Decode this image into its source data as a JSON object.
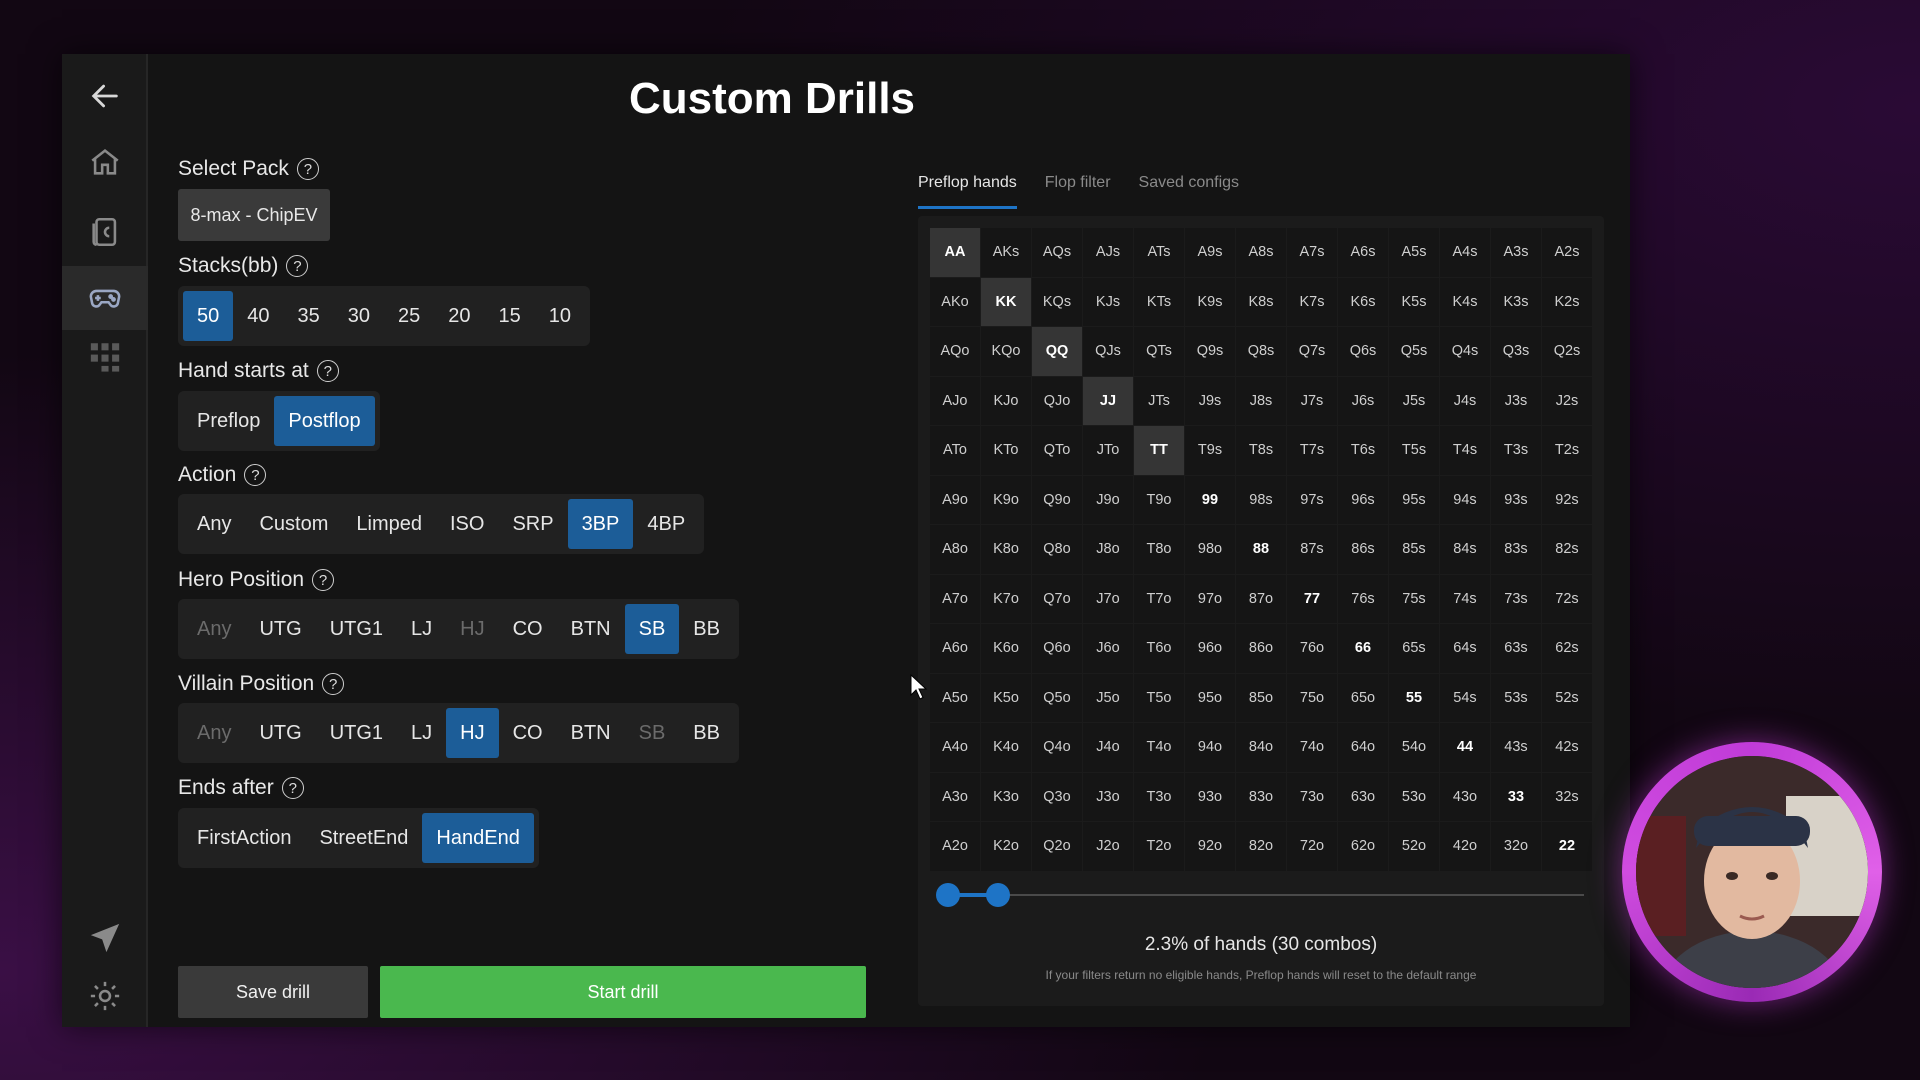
{
  "title": "Custom Drills",
  "sidebar": {
    "icons": [
      "back-arrow-icon",
      "home-icon",
      "cards-icon",
      "gamepad-icon",
      "apps-grid-icon",
      "send-icon",
      "settings-icon"
    ],
    "active": "gamepad-icon"
  },
  "select_pack": {
    "label": "Select Pack",
    "value": "8-max - ChipEV"
  },
  "stacks": {
    "label": "Stacks(bb)",
    "options": [
      "50",
      "40",
      "35",
      "30",
      "25",
      "20",
      "15",
      "10"
    ],
    "selected": "50"
  },
  "hand_starts": {
    "label": "Hand starts at",
    "options": [
      "Preflop",
      "Postflop"
    ],
    "selected": "Postflop"
  },
  "action": {
    "label": "Action",
    "options": [
      "Any",
      "Custom",
      "Limped",
      "ISO",
      "SRP",
      "3BP",
      "4BP"
    ],
    "selected": "3BP"
  },
  "hero_position": {
    "label": "Hero Position",
    "options": [
      "Any",
      "UTG",
      "UTG1",
      "LJ",
      "HJ",
      "CO",
      "BTN",
      "SB",
      "BB"
    ],
    "selected": "SB",
    "disabled": [
      "Any",
      "HJ"
    ]
  },
  "villain_position": {
    "label": "Villain Position",
    "options": [
      "Any",
      "UTG",
      "UTG1",
      "LJ",
      "HJ",
      "CO",
      "BTN",
      "SB",
      "BB"
    ],
    "selected": "HJ",
    "disabled": [
      "Any",
      "SB"
    ]
  },
  "ends_after": {
    "label": "Ends after",
    "options": [
      "FirstAction",
      "StreetEnd",
      "HandEnd"
    ],
    "selected": "HandEnd"
  },
  "buttons": {
    "save": "Save drill",
    "start": "Start drill"
  },
  "tabs": [
    "Preflop hands",
    "Flop filter",
    "Saved configs"
  ],
  "active_tab": "Preflop hands",
  "ranks": [
    "A",
    "K",
    "Q",
    "J",
    "T",
    "9",
    "8",
    "7",
    "6",
    "5",
    "4",
    "3",
    "2"
  ],
  "highlighted_hands": [
    "AA",
    "KK",
    "QQ",
    "JJ",
    "TT"
  ],
  "range_slider": {
    "low": 0,
    "high": 2.3
  },
  "summary": "2.3% of hands (30 combos)",
  "note": "If your filters return no eligible hands, Preflop hands will reset to the default range",
  "colors": {
    "accent": "#1c5d98",
    "start": "#4ab84e",
    "ring": "#c03bd8"
  }
}
